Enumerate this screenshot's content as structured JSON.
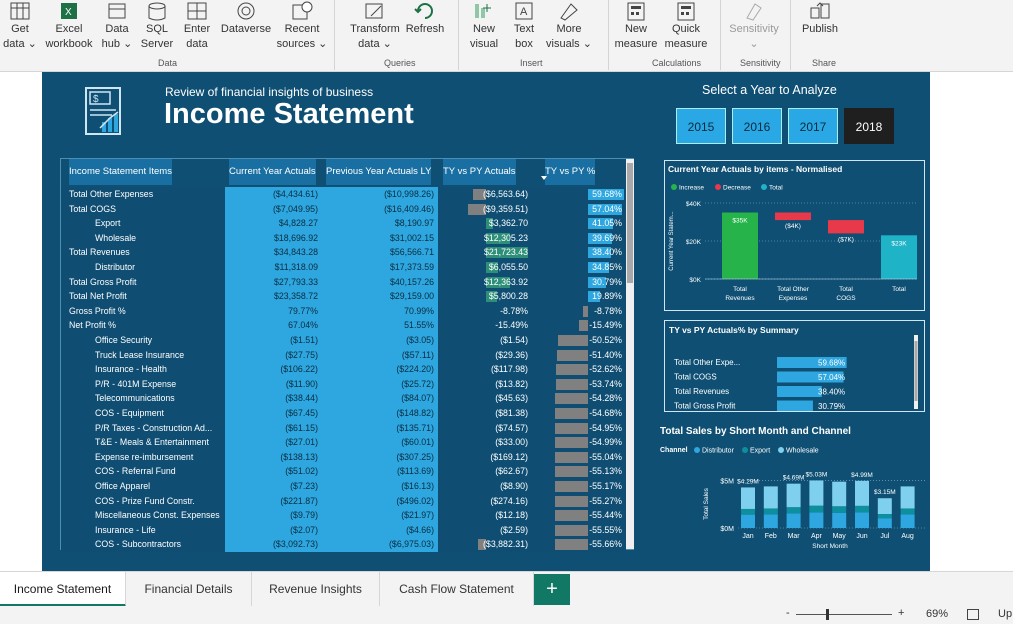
{
  "ribbon": {
    "buttons": [
      {
        "label1": "Get",
        "label2": "data ⌄",
        "icon": "table-icon"
      },
      {
        "label1": "Excel",
        "label2": "workbook",
        "icon": "excel-icon"
      },
      {
        "label1": "Data",
        "label2": "hub ⌄",
        "icon": "data-hub-icon"
      },
      {
        "label1": "SQL",
        "label2": "Server",
        "icon": "sql-server-icon"
      },
      {
        "label1": "Enter",
        "label2": "data",
        "icon": "enter-data-icon"
      },
      {
        "label1": "Dataverse",
        "label2": "",
        "icon": "dataverse-icon"
      },
      {
        "label1": "Recent",
        "label2": "sources ⌄",
        "icon": "recent-sources-icon"
      },
      {
        "label1": "Transform",
        "label2": "data ⌄",
        "icon": "transform-icon"
      },
      {
        "label1": "Refresh",
        "label2": "",
        "icon": "refresh-icon"
      },
      {
        "label1": "New",
        "label2": "visual",
        "icon": "new-visual-icon"
      },
      {
        "label1": "Text",
        "label2": "box",
        "icon": "text-box-icon"
      },
      {
        "label1": "More",
        "label2": "visuals ⌄",
        "icon": "more-visuals-icon"
      },
      {
        "label1": "New",
        "label2": "measure",
        "icon": "new-measure-icon"
      },
      {
        "label1": "Quick",
        "label2": "measure",
        "icon": "quick-measure-icon"
      },
      {
        "label1": "Sensitivity",
        "label2": "⌄",
        "icon": "sensitivity-icon"
      },
      {
        "label1": "Publish",
        "label2": "",
        "icon": "publish-icon"
      }
    ],
    "groups": [
      "Data",
      "Queries",
      "Insert",
      "Calculations",
      "Sensitivity",
      "Share"
    ]
  },
  "report": {
    "subtitle": "Review of financial insights of business",
    "title": "Income Statement",
    "year_prompt": "Select a Year to Analyze",
    "years": [
      "2015",
      "2016",
      "2017",
      "2018"
    ],
    "selected_year": "2018"
  },
  "table": {
    "headers": [
      "Income Statement Items",
      "Current Year Actuals",
      "Previous Year Actuals LY",
      "TY vs PY Actuals",
      "TY vs PY %"
    ],
    "rows": [
      {
        "item": "Total Other Expenses",
        "indent": false,
        "cy": "($4,434.61)",
        "py": "($10,998.26)",
        "diff": "($6,563.64)",
        "diffv": -6563.64,
        "pct": "59.68%",
        "pctv": 59.68
      },
      {
        "item": "Total COGS",
        "indent": false,
        "cy": "($7,049.95)",
        "py": "($16,409.46)",
        "diff": "($9,359.51)",
        "diffv": -9359.51,
        "pct": "57.04%",
        "pctv": 57.04
      },
      {
        "item": "Export",
        "indent": true,
        "cy": "$4,828.27",
        "py": "$8,190.97",
        "diff": "$3,362.70",
        "diffv": 3362.7,
        "pct": "41.05%",
        "pctv": 41.05
      },
      {
        "item": "Wholesale",
        "indent": true,
        "cy": "$18,696.92",
        "py": "$31,002.15",
        "diff": "$12,305.23",
        "diffv": 12305.23,
        "pct": "39.69%",
        "pctv": 39.69
      },
      {
        "item": "Total Revenues",
        "indent": false,
        "cy": "$34,843.28",
        "py": "$56,566.71",
        "diff": "$21,723.43",
        "diffv": 21723.43,
        "pct": "38.40%",
        "pctv": 38.4
      },
      {
        "item": "Distributor",
        "indent": true,
        "cy": "$11,318.09",
        "py": "$17,373.59",
        "diff": "$6,055.50",
        "diffv": 6055.5,
        "pct": "34.85%",
        "pctv": 34.85
      },
      {
        "item": "Total Gross Profit",
        "indent": false,
        "cy": "$27,793.33",
        "py": "$40,157.26",
        "diff": "$12,363.92",
        "diffv": 12363.92,
        "pct": "30.79%",
        "pctv": 30.79
      },
      {
        "item": "Total Net Profit",
        "indent": false,
        "cy": "$23,358.72",
        "py": "$29,159.00",
        "diff": "$5,800.28",
        "diffv": 5800.28,
        "pct": "19.89%",
        "pctv": 19.89
      },
      {
        "item": "Gross Profit %",
        "indent": false,
        "cy": "79.77%",
        "py": "70.99%",
        "diff": "-8.78%",
        "diffv": 0,
        "pct": "-8.78%",
        "pctv": -8.78
      },
      {
        "item": "Net Profit %",
        "indent": false,
        "cy": "67.04%",
        "py": "51.55%",
        "diff": "-15.49%",
        "diffv": 0,
        "pct": "-15.49%",
        "pctv": -15.49
      },
      {
        "item": "Office Security",
        "indent": true,
        "cy": "($1.51)",
        "py": "($3.05)",
        "diff": "($1.54)",
        "diffv": 0,
        "pct": "-50.52%",
        "pctv": -50.52
      },
      {
        "item": "Truck Lease Insurance",
        "indent": true,
        "cy": "($27.75)",
        "py": "($57.11)",
        "diff": "($29.36)",
        "diffv": 0,
        "pct": "-51.40%",
        "pctv": -51.4
      },
      {
        "item": "Insurance - Health",
        "indent": true,
        "cy": "($106.22)",
        "py": "($224.20)",
        "diff": "($117.98)",
        "diffv": 0,
        "pct": "-52.62%",
        "pctv": -52.62
      },
      {
        "item": "P/R - 401M Expense",
        "indent": true,
        "cy": "($11.90)",
        "py": "($25.72)",
        "diff": "($13.82)",
        "diffv": 0,
        "pct": "-53.74%",
        "pctv": -53.74
      },
      {
        "item": "Telecommunications",
        "indent": true,
        "cy": "($38.44)",
        "py": "($84.07)",
        "diff": "($45.63)",
        "diffv": 0,
        "pct": "-54.28%",
        "pctv": -54.28
      },
      {
        "item": "COS - Equipment",
        "indent": true,
        "cy": "($67.45)",
        "py": "($148.82)",
        "diff": "($81.38)",
        "diffv": 0,
        "pct": "-54.68%",
        "pctv": -54.68
      },
      {
        "item": "P/R Taxes - Construction Ad...",
        "indent": true,
        "cy": "($61.15)",
        "py": "($135.71)",
        "diff": "($74.57)",
        "diffv": 0,
        "pct": "-54.95%",
        "pctv": -54.95
      },
      {
        "item": "T&E - Meals & Entertainment",
        "indent": true,
        "cy": "($27.01)",
        "py": "($60.01)",
        "diff": "($33.00)",
        "diffv": 0,
        "pct": "-54.99%",
        "pctv": -54.99
      },
      {
        "item": "Expense re-imbursement",
        "indent": true,
        "cy": "($138.13)",
        "py": "($307.25)",
        "diff": "($169.12)",
        "diffv": 0,
        "pct": "-55.04%",
        "pctv": -55.04
      },
      {
        "item": "COS - Referral Fund",
        "indent": true,
        "cy": "($51.02)",
        "py": "($113.69)",
        "diff": "($62.67)",
        "diffv": 0,
        "pct": "-55.13%",
        "pctv": -55.13
      },
      {
        "item": "Office Apparel",
        "indent": true,
        "cy": "($7.23)",
        "py": "($16.13)",
        "diff": "($8.90)",
        "diffv": 0,
        "pct": "-55.17%",
        "pctv": -55.17
      },
      {
        "item": "COS - Prize Fund Constr.",
        "indent": true,
        "cy": "($221.87)",
        "py": "($496.02)",
        "diff": "($274.16)",
        "diffv": 0,
        "pct": "-55.27%",
        "pctv": -55.27
      },
      {
        "item": "Miscellaneous Const. Expenses",
        "indent": true,
        "cy": "($9.79)",
        "py": "($21.97)",
        "diff": "($12.18)",
        "diffv": 0,
        "pct": "-55.44%",
        "pctv": -55.44
      },
      {
        "item": "Insurance - Life",
        "indent": true,
        "cy": "($2.07)",
        "py": "($4.66)",
        "diff": "($2.59)",
        "diffv": 0,
        "pct": "-55.55%",
        "pctv": -55.55
      },
      {
        "item": "COS - Subcontractors",
        "indent": true,
        "cy": "($3,092.73)",
        "py": "($6,975.03)",
        "diff": "($3,882.31)",
        "diffv": -3882.31,
        "pct": "-55.66%",
        "pctv": -55.66
      }
    ]
  },
  "chart_data": [
    {
      "type": "bar",
      "subtype": "waterfall",
      "title": "Current Year Actuals by items - Normalised",
      "legend": [
        "Increase",
        "Decrease",
        "Total"
      ],
      "legend_colors": [
        "#25b34a",
        "#e8394a",
        "#1fb3c7"
      ],
      "ylabel": "Current Year Statem...",
      "yticks": [
        "$40K",
        "$20K",
        "$0K"
      ],
      "ylim": [
        0,
        40
      ],
      "categories": [
        "Total Revenues",
        "Total Other Expenses",
        "Total COGS",
        "Total"
      ],
      "values": [
        35,
        -4,
        -7,
        23
      ],
      "labels": [
        "$35K",
        "($4K)",
        "($7K)",
        "$23K"
      ]
    },
    {
      "type": "bar",
      "orientation": "horizontal",
      "title": "TY vs PY Actuals% by Summary",
      "categories": [
        "Total Other Expe...",
        "Total COGS",
        "Total Revenues",
        "Total Gross Profit"
      ],
      "values": [
        59.68,
        57.04,
        38.4,
        30.79
      ],
      "labels": [
        "59.68%",
        "57.04%",
        "38.40%",
        "30.79%"
      ]
    },
    {
      "type": "bar",
      "subtype": "stacked",
      "title": "Total Sales by Short Month and Channel",
      "legend_title": "Channel",
      "series_names": [
        "Distributor",
        "Export",
        "Wholesale"
      ],
      "series_colors": [
        "#2ea6df",
        "#0e8fa0",
        "#7fd0ee"
      ],
      "categories": [
        "Jan",
        "Feb",
        "Mar",
        "Apr",
        "May",
        "Jun",
        "Jul",
        "Aug"
      ],
      "totals": [
        4.29,
        4.4,
        4.69,
        5.03,
        4.9,
        4.99,
        3.15,
        4.4
      ],
      "total_labels": [
        "$4.29M",
        "",
        "$4.69M",
        "$5.03M",
        "",
        "$4.99M",
        "$3.15M",
        ""
      ],
      "yticks": [
        "$5M",
        "$0M"
      ],
      "ylim": [
        0,
        5.5
      ],
      "xlabel": "Short Month",
      "ylabel": "Total Sales"
    }
  ],
  "tabs": [
    "Income Statement",
    "Financial Details",
    "Revenue Insights",
    "Cash Flow Statement"
  ],
  "add_tab": "+",
  "status": {
    "zoom": "69%",
    "minus": "-",
    "plus": "+",
    "trail": "Up"
  }
}
